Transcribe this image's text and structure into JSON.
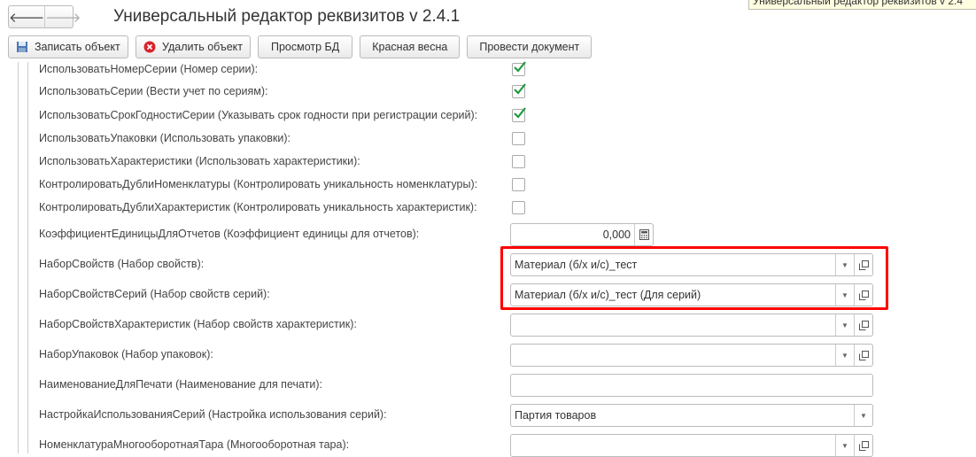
{
  "window": {
    "title": "Универсальный редактор реквизитов v 2.4.1",
    "tooltip": "Универсальный редактор реквизитов v 2.4",
    "back": "🡐",
    "forward": "🡒"
  },
  "toolbar": {
    "save": "Записать объект",
    "delete": "Удалить объект",
    "view_db": "Просмотр БД",
    "red_spring": "Красная весна",
    "post_doc": "Провести документ"
  },
  "checkboxes": [
    {
      "label": "ИспользоватьНомерСерии (Номер серии):",
      "checked": true
    },
    {
      "label": "ИспользоватьСерии (Вести учет по сериям):",
      "checked": true
    },
    {
      "label": "ИспользоватьСрокГодностиСерии (Указывать срок годности при регистрации серий):",
      "checked": true
    },
    {
      "label": "ИспользоватьУпаковки (Использовать упаковки):",
      "checked": false
    },
    {
      "label": "ИспользоватьХарактеристики (Использовать характеристики):",
      "checked": false
    },
    {
      "label": "КонтролироватьДублиНоменклатуры (Контролировать уникальность номенклатуры):",
      "checked": false
    },
    {
      "label": "КонтролироватьДублиХарактеристик (Контролировать уникальность характеристик):",
      "checked": false
    }
  ],
  "fields": {
    "coef": {
      "label": "КоэффициентЕдиницыДляОтчетов (Коэффициент единицы для отчетов):",
      "value": "0,000"
    },
    "props": {
      "label": "НаборСвойств (Набор свойств):",
      "value": "Материал (б/х и/с)_тест"
    },
    "props_series": {
      "label": "НаборСвойствСерий (Набор свойств серий):",
      "value": "Материал (б/х и/с)_тест (Для серий)"
    },
    "props_char": {
      "label": "НаборСвойствХарактеристик (Набор свойств характеристик):",
      "value": ""
    },
    "packs": {
      "label": "НаборУпаковок (Набор упаковок):",
      "value": ""
    },
    "print_name": {
      "label": "НаименованиеДляПечати (Наименование для печати):",
      "value": ""
    },
    "series_setting": {
      "label": "НастройкаИспользованияСерий (Настройка использования серий):",
      "value": "Партия товаров"
    },
    "tara": {
      "label": "НоменклатураМногооборотнаяТара (Многооборотная тара):",
      "value": ""
    }
  }
}
